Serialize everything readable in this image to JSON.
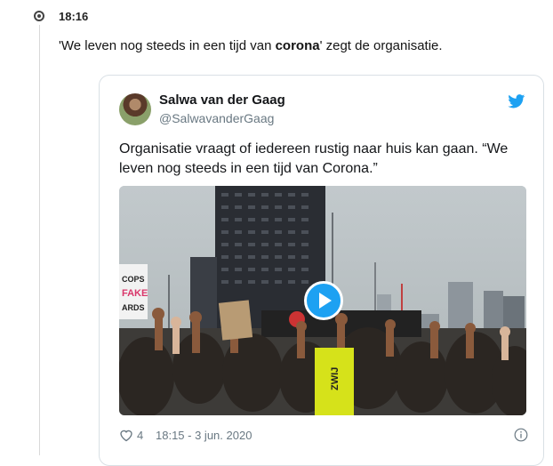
{
  "entry": {
    "time": "18:16",
    "text_before": "'We leven nog steeds in een tijd van ",
    "text_bold": "corona",
    "text_after": "' zegt de organisatie."
  },
  "tweet": {
    "name": "Salwa van der Gaag",
    "handle": "@SalwavanderGaag",
    "text": "Organisatie vraagt of iedereen rustig naar huis kan gaan. “We leven nog steeds in een tijd van Corona.”",
    "likes": "4",
    "date": "18:15 - 3 jun. 2020",
    "brand_color": "#1da1f2",
    "media": {
      "sign_left": "COPS ARE FAKE ...ARDS",
      "banner_text": "ZWIJ",
      "play_icon": "play-icon"
    }
  }
}
